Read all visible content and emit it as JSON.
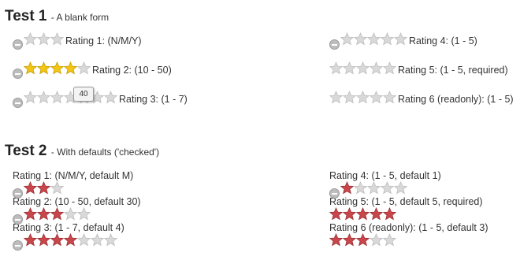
{
  "colors": {
    "star_off": "#d9d9d9",
    "star_gold": "#f3c613",
    "star_red": "#c9474c"
  },
  "test1": {
    "title": "Test 1",
    "subtitle": "- A blank form",
    "ratings": [
      {
        "label": "Rating 1: (N/M/Y)",
        "cancel": true,
        "stars": 3,
        "filled": 0,
        "fill": "gold"
      },
      {
        "label": "Rating 2: (10 - 50)",
        "cancel": true,
        "stars": 5,
        "filled": 4,
        "fill": "gold"
      },
      {
        "label": "Rating 3: (1 - 7)",
        "cancel": true,
        "stars": 7,
        "filled": 0,
        "fill": "gold",
        "tooltip": "40"
      },
      {
        "label": "Rating 4: (1 - 5)",
        "cancel": true,
        "stars": 5,
        "filled": 0,
        "fill": "gold"
      },
      {
        "label": "Rating 5: (1 - 5, required)",
        "cancel": false,
        "stars": 5,
        "filled": 0,
        "fill": "gold"
      },
      {
        "label": "Rating 6 (readonly): (1 - 5)",
        "cancel": false,
        "stars": 5,
        "filled": 0,
        "fill": "gold"
      }
    ]
  },
  "test2": {
    "title": "Test 2",
    "subtitle": "- With defaults ('checked')",
    "ratings": [
      {
        "label": "Rating 1: (N/M/Y, default M)",
        "cancel": true,
        "stars": 3,
        "filled": 2,
        "fill": "red"
      },
      {
        "label": "Rating 2: (10 - 50, default 30)",
        "cancel": true,
        "stars": 5,
        "filled": 3,
        "fill": "red"
      },
      {
        "label": "Rating 3: (1 - 7, default 4)",
        "cancel": true,
        "stars": 7,
        "filled": 4,
        "fill": "red"
      },
      {
        "label": "Rating 4: (1 - 5, default 1)",
        "cancel": true,
        "stars": 5,
        "filled": 1,
        "fill": "red"
      },
      {
        "label": "Rating 5: (1 - 5, default 5, required)",
        "cancel": false,
        "stars": 5,
        "filled": 5,
        "fill": "red"
      },
      {
        "label": "Rating 6 (readonly): (1 - 5, default 3)",
        "cancel": false,
        "stars": 5,
        "filled": 3,
        "fill": "red"
      }
    ]
  }
}
